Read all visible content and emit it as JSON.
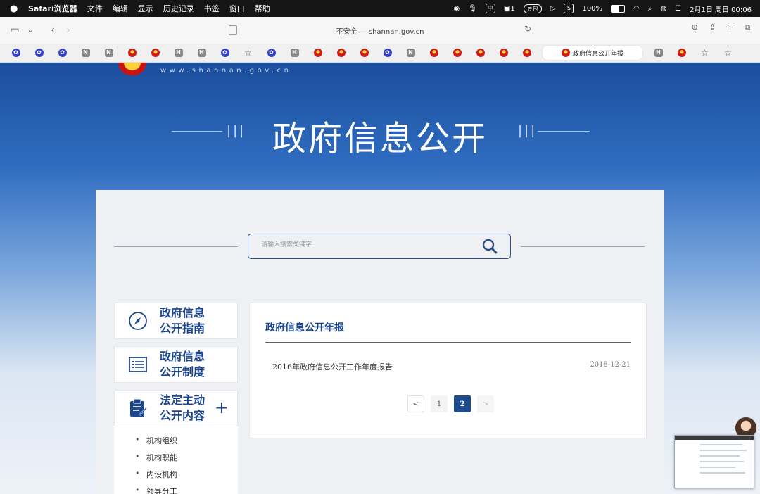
{
  "menubar": {
    "app_name": "Safari浏览器",
    "menus": [
      "文件",
      "编辑",
      "显示",
      "历史记录",
      "书签",
      "窗口",
      "帮助"
    ],
    "status": {
      "wechat_count": "1",
      "douban": "豆包",
      "battery": "100%",
      "datetime": "2月1日 周日  00:06"
    }
  },
  "toolbar": {
    "url_text": "不安全 — shannan.gov.cn"
  },
  "favorites": {
    "icons": [
      "paw",
      "paw",
      "paw",
      "N",
      "N",
      "emblem",
      "emblem",
      "H",
      "H",
      "paw",
      "star",
      "paw",
      "H",
      "emblem",
      "emblem",
      "emblem",
      "paw",
      "N",
      "emblem",
      "emblem",
      "emblem",
      "emblem",
      "emblem",
      "emblem"
    ],
    "active_tab": "政府信息公开年报",
    "trailing_icons": [
      "H",
      "emblem",
      "star",
      "star"
    ]
  },
  "page": {
    "site_url": "www.shannan.gov.cn",
    "banner_title": "政府信息公开",
    "search_placeholder": "请输入搜索关键字",
    "sidebar": [
      {
        "line1": "政府信息",
        "line2": "公开指南"
      },
      {
        "line1": "政府信息",
        "line2": "公开制度"
      },
      {
        "line1": "法定主动",
        "line2": "公开内容",
        "expand": "+"
      }
    ],
    "subitems": [
      "机构组织",
      "机构职能",
      "内设机构",
      "领导分工"
    ],
    "content": {
      "heading": "政府信息公开年报",
      "rows": [
        {
          "title": "2016年政府信息公开工作年度报告",
          "date": "2018-12-21"
        }
      ],
      "pager": {
        "prev": "<",
        "pages": [
          "1",
          "2"
        ],
        "current": "2",
        "next": ">"
      }
    }
  }
}
